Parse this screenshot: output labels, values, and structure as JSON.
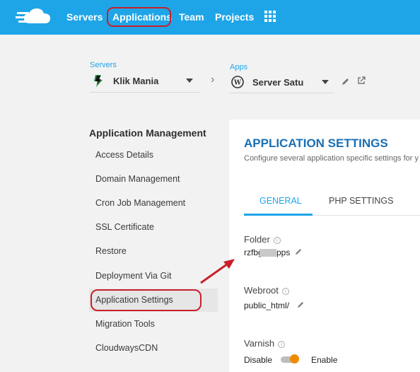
{
  "topnav": {
    "items": [
      "Servers",
      "Applications",
      "Team",
      "Projects"
    ]
  },
  "selectors": {
    "server_label": "Servers",
    "server_value": "Klik Mania",
    "app_label": "Apps",
    "app_value": "Server Satu"
  },
  "sidebar": {
    "title": "Application Management",
    "items": [
      "Access Details",
      "Domain Management",
      "Cron Job Management",
      "SSL Certificate",
      "Restore",
      "Deployment Via Git",
      "Application Settings",
      "Migration Tools",
      "CloudwaysCDN"
    ],
    "active_index": 6
  },
  "settings": {
    "title": "APPLICATION SETTINGS",
    "subtitle": "Configure several application specific settings for y",
    "tabs": [
      "GENERAL",
      "PHP SETTINGS"
    ],
    "folder_label": "Folder",
    "folder_value_start": "rzfbg",
    "folder_value_end": "pps",
    "webroot_label": "Webroot",
    "webroot_value": "public_html/",
    "varnish_label": "Varnish",
    "varnish_off": "Disable",
    "varnish_on": "Enable"
  },
  "colors": {
    "topbar": "#1ea5e8",
    "accent": "#1ea5e8",
    "title": "#1a6fb5",
    "annotation": "#c8202b",
    "toggle": "#f08a00"
  }
}
